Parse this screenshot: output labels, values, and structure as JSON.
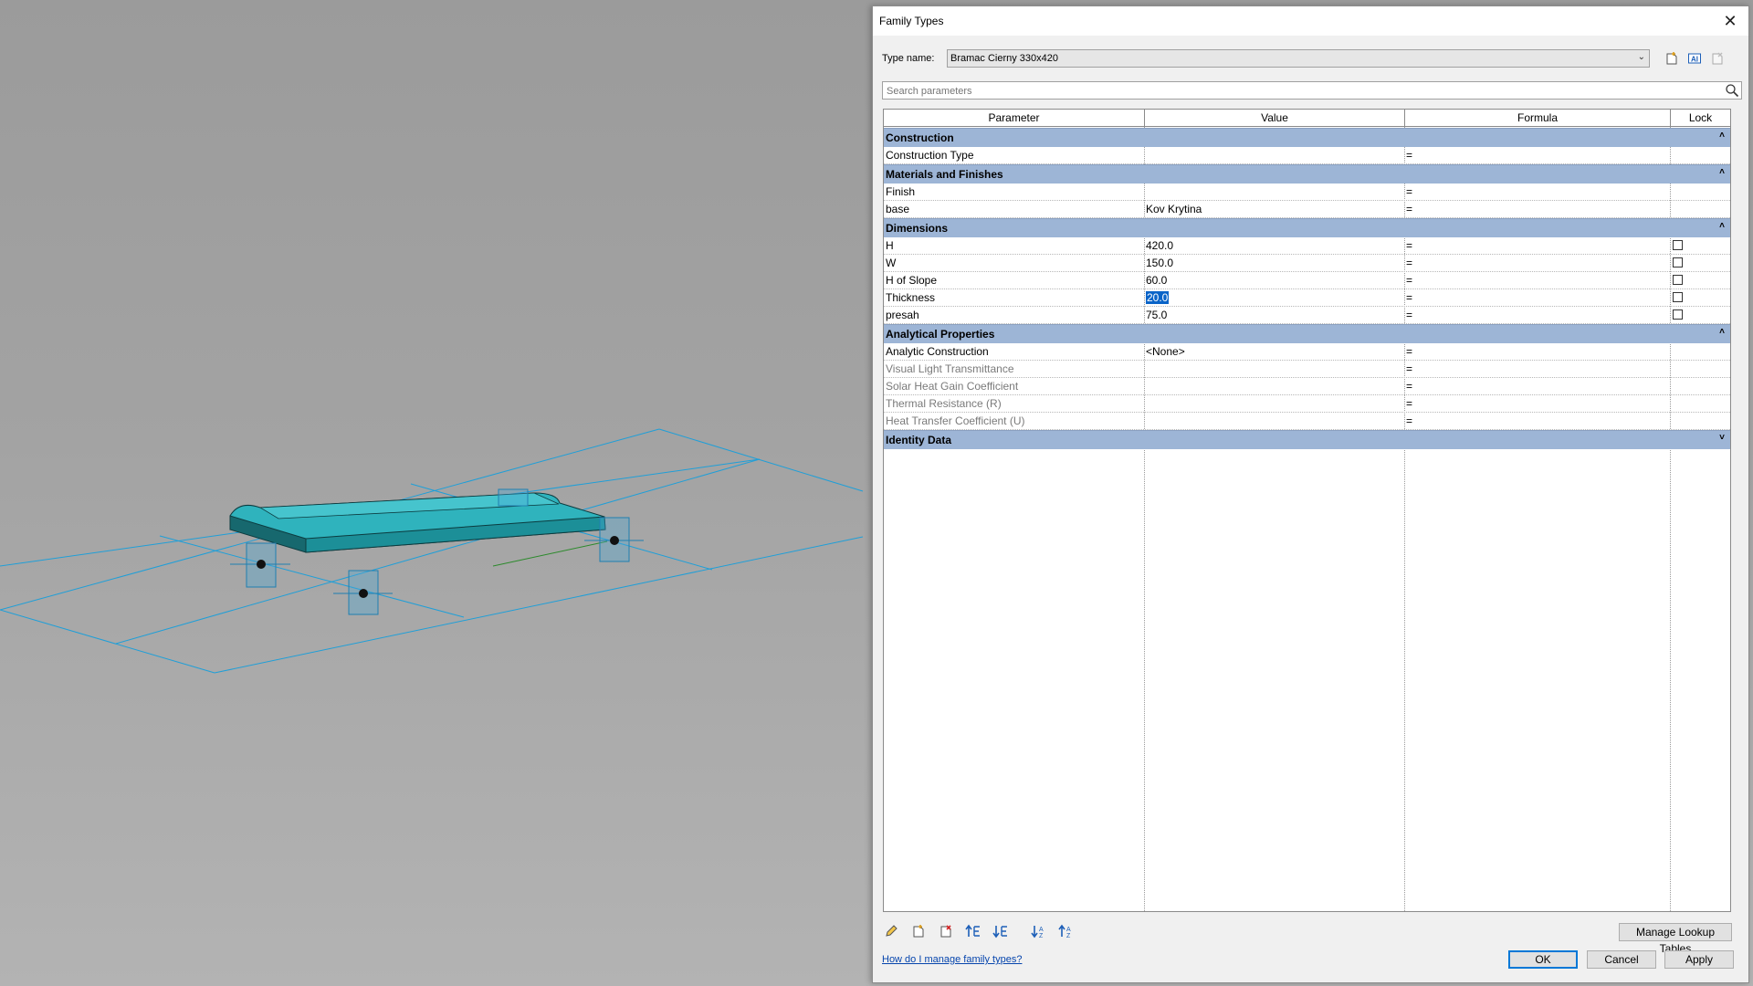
{
  "dialog": {
    "title": "Family Types",
    "type_name_label": "Type name:",
    "type_name_value": "Bramac Cierny 330x420",
    "search_placeholder": "Search parameters",
    "columns": [
      "Parameter",
      "Value",
      "Formula",
      "Lock"
    ],
    "groups": [
      {
        "name": "Construction",
        "expanded": true,
        "rows": [
          {
            "parameter": "Construction Type",
            "value": "",
            "formula": "=",
            "lock": false,
            "has_lock": false,
            "dim": false
          }
        ]
      },
      {
        "name": "Materials and Finishes",
        "expanded": true,
        "rows": [
          {
            "parameter": "Finish",
            "value": "",
            "formula": "=",
            "has_lock": false,
            "dim": false
          },
          {
            "parameter": "base",
            "value": "Kov Krytina",
            "formula": "=",
            "has_lock": false,
            "dim": false
          }
        ]
      },
      {
        "name": "Dimensions",
        "expanded": true,
        "rows": [
          {
            "parameter": "H",
            "value": "420.0",
            "formula": "=",
            "has_lock": true,
            "dim": false
          },
          {
            "parameter": "W",
            "value": "150.0",
            "formula": "=",
            "has_lock": true,
            "dim": false
          },
          {
            "parameter": "H of Slope",
            "value": "60.0",
            "formula": "=",
            "has_lock": true,
            "dim": false
          },
          {
            "parameter": "Thickness",
            "value": "20.0",
            "formula": "=",
            "has_lock": true,
            "dim": false,
            "selected": true
          },
          {
            "parameter": "presah",
            "value": "75.0",
            "formula": "=",
            "has_lock": true,
            "dim": false
          }
        ]
      },
      {
        "name": "Analytical Properties",
        "expanded": true,
        "rows": [
          {
            "parameter": "Analytic Construction",
            "value": "<None>",
            "formula": "=",
            "has_lock": false,
            "dim": false
          },
          {
            "parameter": "Visual Light Transmittance",
            "value": "",
            "formula": "=",
            "has_lock": false,
            "dim": true
          },
          {
            "parameter": "Solar Heat Gain Coefficient",
            "value": "",
            "formula": "=",
            "has_lock": false,
            "dim": true
          },
          {
            "parameter": "Thermal Resistance (R)",
            "value": "",
            "formula": "=",
            "has_lock": false,
            "dim": true
          },
          {
            "parameter": "Heat Transfer Coefficient (U)",
            "value": "",
            "formula": "=",
            "has_lock": false,
            "dim": true
          }
        ]
      },
      {
        "name": "Identity Data",
        "expanded": false,
        "rows": []
      }
    ],
    "manage_lookup_label": "Manage Lookup Tables",
    "help_link": "How do I manage family types?",
    "ok_label": "OK",
    "cancel_label": "Cancel",
    "apply_label": "Apply",
    "bottom_tools": [
      "edit-pencil-icon",
      "new-parameter-icon",
      "delete-parameter-icon",
      "move-up-icon",
      "move-down-icon",
      "sort-ascending-icon",
      "sort-descending-icon"
    ],
    "type_toolbar": [
      "new-type-icon",
      "rename-type-icon",
      "delete-type-icon"
    ]
  },
  "colors": {
    "group_header": "#9db5d6",
    "model": "#2fb3bd",
    "selection": "#0a64c8",
    "reference_lines": "#1f9fd8"
  }
}
